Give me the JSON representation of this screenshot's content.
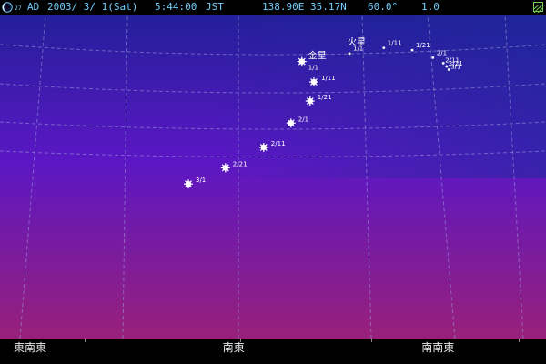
{
  "status_bar": {
    "era": "AD",
    "date": "2003/ 3/ 1(Sat)",
    "time": "5:44:00",
    "timezone": "JST",
    "location": "138.90E 35.17N",
    "fov": "60.0°",
    "magnitude": "1.0",
    "moon_age": "27"
  },
  "colors": {
    "sky_top": "#231f9a",
    "sky_mid": "#5b17c4",
    "sky_bottom": "#98207a",
    "grid": "#9fa0d8",
    "bar_text": "#6fd0ff",
    "planet": "#ffffff",
    "label": "#ffffff"
  },
  "planets": [
    {
      "id": "venus",
      "name": "金星",
      "points": [
        {
          "label": "1/1",
          "xn": 0.553,
          "yn": 0.145
        },
        {
          "label": "1/11",
          "xn": 0.575,
          "yn": 0.208
        },
        {
          "label": "1/21",
          "xn": 0.568,
          "yn": 0.267
        },
        {
          "label": "2/1",
          "xn": 0.533,
          "yn": 0.335
        },
        {
          "label": "2/11",
          "xn": 0.483,
          "yn": 0.41
        },
        {
          "label": "2/21",
          "xn": 0.413,
          "yn": 0.473
        },
        {
          "label": "3/1",
          "xn": 0.345,
          "yn": 0.523
        }
      ]
    },
    {
      "id": "mars",
      "name": "火星",
      "points": [
        {
          "label": "1/1",
          "xn": 0.64,
          "yn": 0.12
        },
        {
          "label": "1/11",
          "xn": 0.703,
          "yn": 0.103
        },
        {
          "label": "1/21",
          "xn": 0.755,
          "yn": 0.11
        },
        {
          "label": "2/1",
          "xn": 0.793,
          "yn": 0.133
        },
        {
          "label": "2/11",
          "xn": 0.812,
          "yn": 0.15
        },
        {
          "label": "2/21",
          "xn": 0.818,
          "yn": 0.16
        },
        {
          "label": "3/1",
          "xn": 0.822,
          "yn": 0.17
        }
      ]
    }
  ],
  "horizon_labels": [
    {
      "text": "東南東",
      "xn": 0.025
    },
    {
      "text": "南東",
      "xn": 0.408
    },
    {
      "text": "南南東",
      "xn": 0.772
    }
  ]
}
